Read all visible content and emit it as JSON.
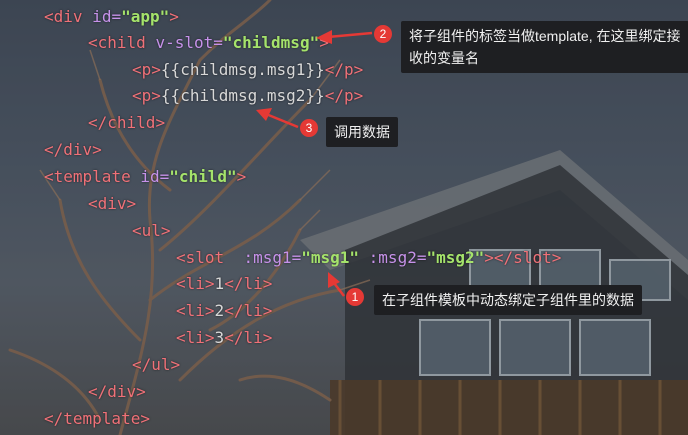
{
  "code_lines": [
    {
      "open": "<",
      "tag": "div",
      "attr": " id=",
      "val": "\"app\"",
      "close": ">"
    },
    {
      "open": "<",
      "tag": "child",
      "attr": " v-slot=",
      "val": "\"childmsg\"",
      "close": ">"
    },
    {
      "open": "<",
      "tag": "p",
      "close": ">",
      "text": "{{childmsg.msg1}}",
      "end_open": "</",
      "end_tag": "p",
      "end_close": ">"
    },
    {
      "open": "<",
      "tag": "p",
      "close": ">",
      "text": "{{childmsg.msg2}}",
      "end_open": "</",
      "end_tag": "p",
      "end_close": ">"
    },
    {
      "open": "</",
      "tag": "child",
      "close": ">"
    },
    {
      "open": "</",
      "tag": "div",
      "close": ">"
    },
    {
      "open": "<",
      "tag": "template",
      "attr": " id=",
      "val": "\"child\"",
      "close": ">"
    },
    {
      "open": "<",
      "tag": "div",
      "close": ">"
    },
    {
      "open": "<",
      "tag": "ul",
      "close": ">"
    },
    {
      "slot_line": true
    },
    {
      "open": "<",
      "tag": "li",
      "close": ">",
      "text": "1",
      "end_open": "</",
      "end_tag": "li",
      "end_close": ">"
    },
    {
      "open": "<",
      "tag": "li",
      "close": ">",
      "text": "2",
      "end_open": "</",
      "end_tag": "li",
      "end_close": ">"
    },
    {
      "open": "<",
      "tag": "li",
      "close": ">",
      "text": "3",
      "end_open": "</",
      "end_tag": "li",
      "end_close": ">"
    },
    {
      "open": "</",
      "tag": "ul",
      "close": ">"
    },
    {
      "open": "</",
      "tag": "div",
      "close": ">"
    },
    {
      "open": "</",
      "tag": "template",
      "close": ">"
    }
  ],
  "slot_line": {
    "open": "<",
    "tag": "slot",
    "attr1": "  :msg1=",
    "val1": "\"msg1\"",
    "attr2": " :msg2=",
    "val2": "\"msg2\"",
    "mid": ">",
    "end_open": "</",
    "end_tag": "slot",
    "end_close": ">"
  },
  "annotations": {
    "a1": {
      "num": "1",
      "text": "在子组件模板中动态绑定子组件里的数据"
    },
    "a2": {
      "num": "2",
      "text": "将子组件的标签当做template, 在这里绑定接收的变量名"
    },
    "a3": {
      "num": "3",
      "text": "调用数据"
    }
  },
  "colors": {
    "badge": "#e53935",
    "tag": "#f07178",
    "attr": "#c792ea",
    "string": "#a5e36b"
  }
}
